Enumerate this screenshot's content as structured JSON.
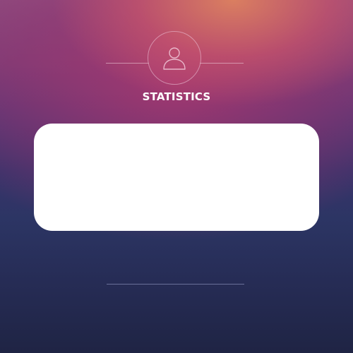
{
  "header": {
    "title": "STATISTICS",
    "avatar_icon": "user-icon"
  },
  "colors": {
    "title_text": "#ffffff",
    "card_background": "#ffffff",
    "outline": "#f0c8dc"
  }
}
